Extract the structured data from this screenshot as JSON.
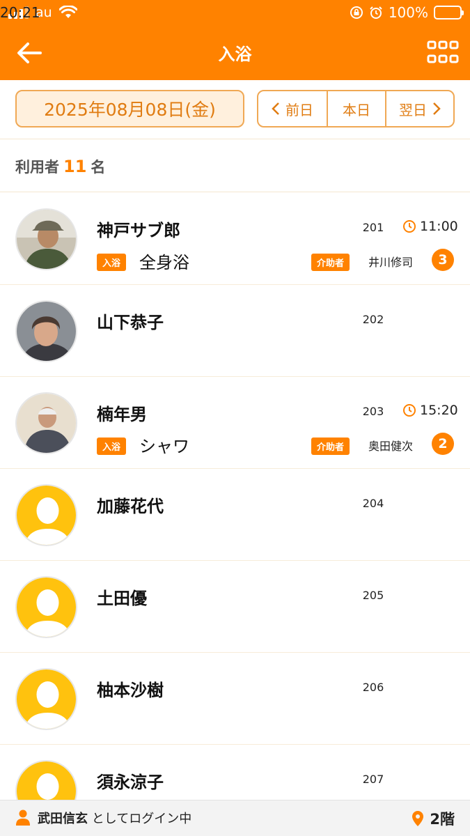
{
  "status_bar": {
    "carrier": "au",
    "time": "20:21",
    "battery": "100%"
  },
  "header": {
    "title": "入浴"
  },
  "date_bar": {
    "date": "2025年08月08日(金)",
    "prev_label": "前日",
    "today_label": "本日",
    "next_label": "翌日"
  },
  "count": {
    "prefix": "利用者",
    "number": "11",
    "suffix": "名"
  },
  "residents": [
    {
      "name": "神戸サブ郎",
      "room": "201",
      "time": "11:00",
      "bath_badge": "入浴",
      "bath_type": "全身浴",
      "helper_badge": "介助者",
      "helper": "井川修司",
      "count": "3",
      "avatar": "photo-elder-man-cap"
    },
    {
      "name": "山下恭子",
      "room": "202",
      "avatar": "photo-elder-woman"
    },
    {
      "name": "楠年男",
      "room": "203",
      "time": "15:20",
      "bath_badge": "入浴",
      "bath_type": "シャワ",
      "helper_badge": "介助者",
      "helper": "奥田健次",
      "count": "2",
      "avatar": "photo-elder-man-bald"
    },
    {
      "name": "加藤花代",
      "room": "204",
      "avatar": "placeholder-avatar"
    },
    {
      "name": "土田優",
      "room": "205",
      "avatar": "placeholder-avatar"
    },
    {
      "name": "柚本沙樹",
      "room": "206",
      "avatar": "placeholder-avatar"
    },
    {
      "name": "須永涼子",
      "room": "207",
      "avatar": "placeholder-avatar"
    }
  ],
  "footer": {
    "user": "武田信玄",
    "login_suffix": "としてログイン中",
    "floor": "2階"
  },
  "colors": {
    "accent": "#FF8200",
    "date_bg": "#FFF0DD",
    "placeholder": "#FFC20E"
  }
}
